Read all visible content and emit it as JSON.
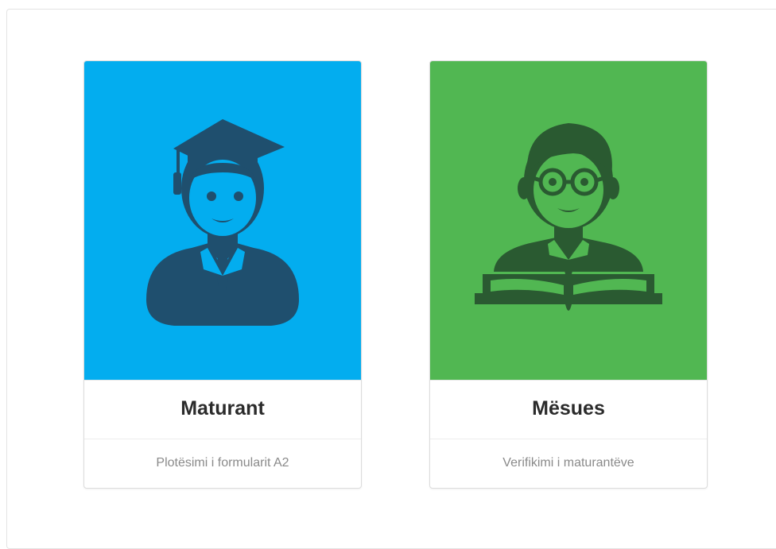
{
  "cards": [
    {
      "title": "Maturant",
      "subtitle": "Plotësimi i formularit A2",
      "icon": "graduate-student-icon",
      "color": "#03adef"
    },
    {
      "title": "Mësues",
      "subtitle": "Verifikimi i maturantëve",
      "icon": "teacher-with-book-icon",
      "color": "#51b752"
    }
  ],
  "colors": {
    "student_bg": "#03adef",
    "student_icon": "#1f4f6e",
    "teacher_bg": "#51b752",
    "teacher_icon": "#2a5a31"
  }
}
